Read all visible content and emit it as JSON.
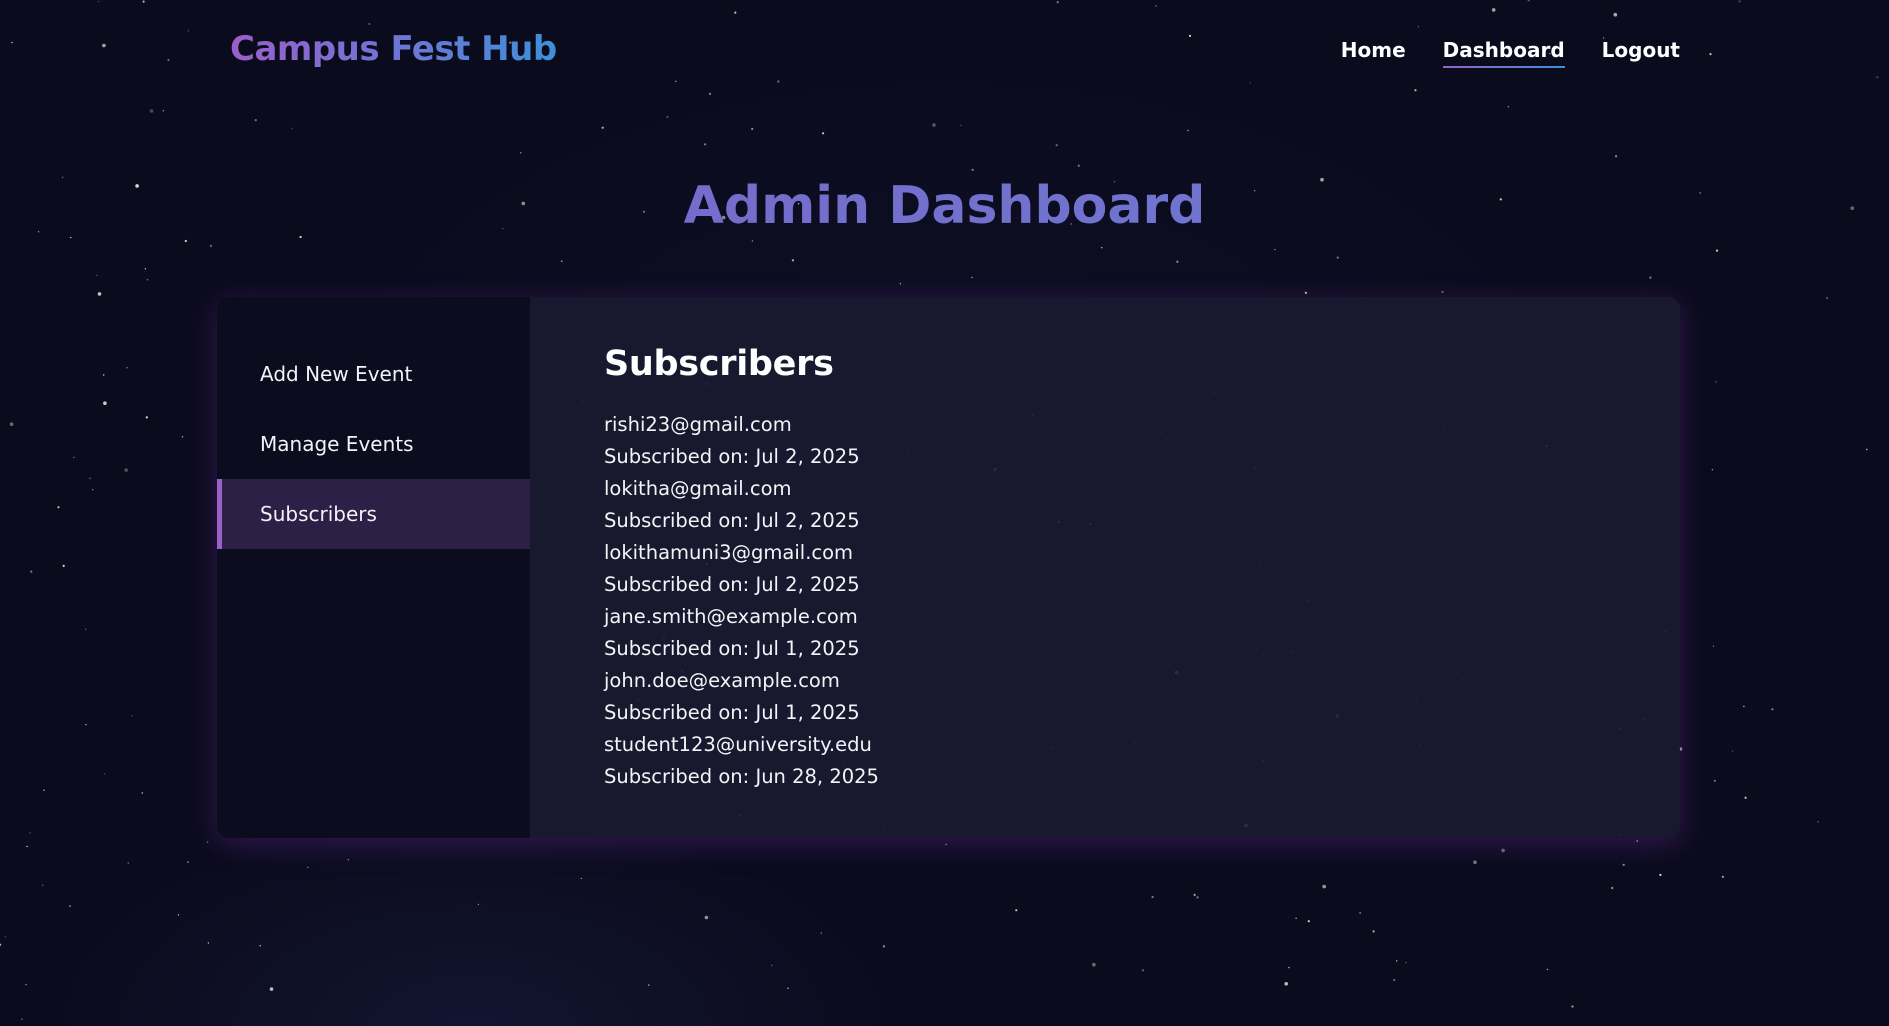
{
  "header": {
    "brand": "Campus Fest Hub",
    "nav": [
      {
        "label": "Home",
        "active": false
      },
      {
        "label": "Dashboard",
        "active": true
      },
      {
        "label": "Logout",
        "active": false
      }
    ]
  },
  "page_title": "Admin Dashboard",
  "sidebar": {
    "items": [
      {
        "label": "Add New Event",
        "active": false
      },
      {
        "label": "Manage Events",
        "active": false
      },
      {
        "label": "Subscribers",
        "active": true
      }
    ]
  },
  "main": {
    "section_title": "Subscribers",
    "subscribers": [
      {
        "email": "rishi23@gmail.com",
        "subscribed": "Subscribed on: Jul 2, 2025"
      },
      {
        "email": "lokitha@gmail.com",
        "subscribed": "Subscribed on: Jul 2, 2025"
      },
      {
        "email": "lokithamuni3@gmail.com",
        "subscribed": "Subscribed on: Jul 2, 2025"
      },
      {
        "email": "jane.smith@example.com",
        "subscribed": "Subscribed on: Jul 1, 2025"
      },
      {
        "email": "john.doe@example.com",
        "subscribed": "Subscribed on: Jul 1, 2025"
      },
      {
        "email": "student123@university.edu",
        "subscribed": "Subscribed on: Jun 28, 2025"
      }
    ]
  },
  "colors": {
    "background": "#0b0b1e",
    "panel": "#1a1b30",
    "sidebar": "#0c0c1f",
    "active_item": "#2e1f47",
    "accent_purple": "#9b5fc8",
    "accent_blue": "#3e8fd8",
    "title": "#6c73c7"
  }
}
